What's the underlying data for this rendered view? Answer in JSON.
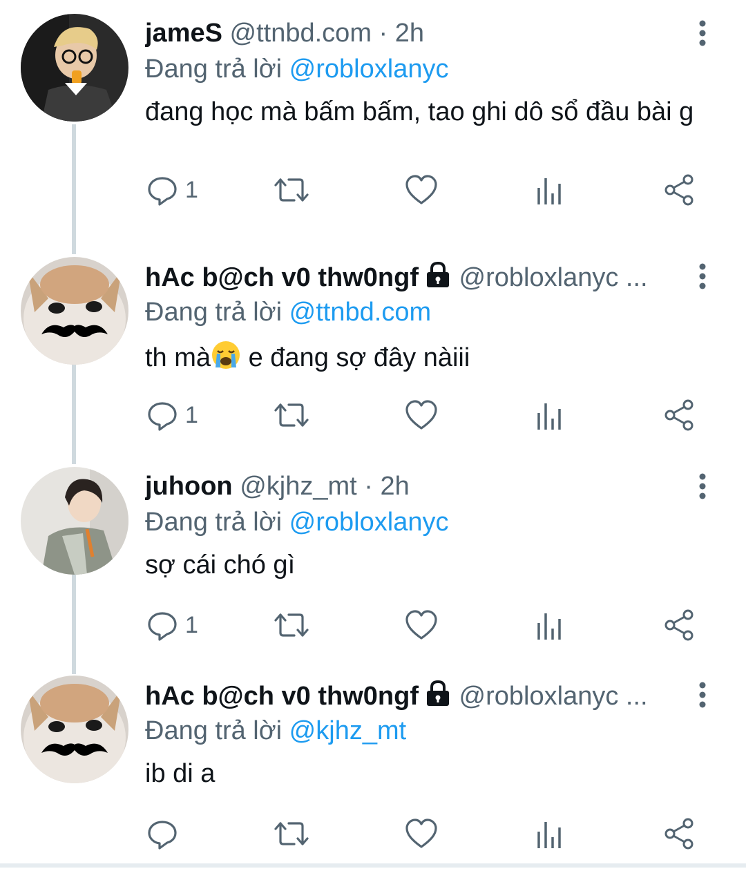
{
  "tweets": [
    {
      "name": "jameS",
      "handle": "@ttnbd.com · 2h",
      "protected": false,
      "replying_prefix": "Đang trả lời ",
      "replying_to": "@robloxlanyc",
      "content": "đang học mà bấm bấm, tao ghi dô sổ đầu bài g",
      "reply_count": "1",
      "avatar": "person-glasses-avatar"
    },
    {
      "name": "hAc b@ch v0 thw0ngf",
      "handle": "@robloxlanyc ...",
      "protected": true,
      "replying_prefix": "Đang trả lời ",
      "replying_to": "@ttnbd.com",
      "content_before": "th mà",
      "content_emoji": "loudly-crying-face-emoji",
      "content_after": " e đang sợ đây nàiii",
      "reply_count": "1",
      "avatar": "cat-mustache-avatar"
    },
    {
      "name": "juhoon",
      "handle": "@kjhz_mt · 2h",
      "protected": false,
      "replying_prefix": "Đang trả lời ",
      "replying_to": "@robloxlanyc",
      "content": "sợ cái chó gì",
      "reply_count": "1",
      "avatar": "person-jacket-avatar"
    },
    {
      "name": "hAc b@ch v0 thw0ngf",
      "handle": "@robloxlanyc ...",
      "protected": true,
      "replying_prefix": "Đang trả lời ",
      "replying_to": "@kjhz_mt",
      "content": "ib di a",
      "reply_count": "",
      "avatar": "cat-mustache-avatar"
    }
  ],
  "icons": {
    "reply": "reply-icon",
    "retweet": "retweet-icon",
    "like": "heart-icon",
    "views": "analytics-icon",
    "share": "share-icon",
    "more": "more-vertical-icon",
    "lock": "lock-icon"
  },
  "colors": {
    "text": "#0f1419",
    "secondary": "#536471",
    "mention": "#1d9bf0",
    "thread_line": "#cfd9de"
  }
}
